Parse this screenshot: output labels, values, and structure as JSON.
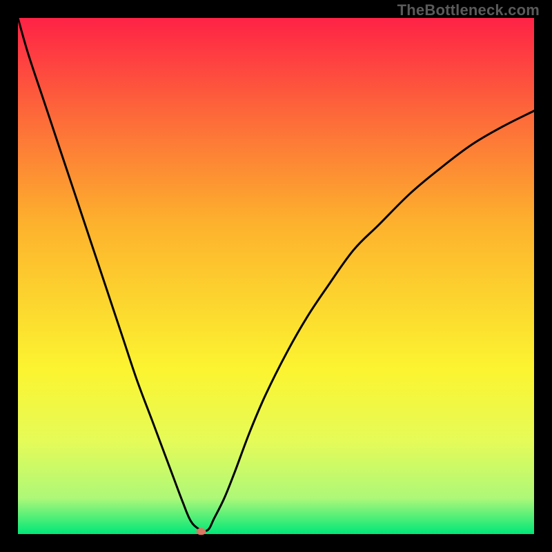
{
  "watermark": "TheBottleneck.com",
  "colors": {
    "gradient_top": "#fe2246",
    "gradient_mid1": "#fd663a",
    "gradient_mid2": "#fdb22d",
    "gradient_mid3": "#fcf430",
    "gradient_mid4": "#e5fb58",
    "gradient_mid5": "#aef878",
    "gradient_bottom": "#00e778",
    "curve": "#000000",
    "marker": "#d97863",
    "frame": "#000000"
  },
  "chart_data": {
    "type": "line",
    "title": "",
    "xlabel": "",
    "ylabel": "",
    "xlim": [
      0,
      100
    ],
    "ylim": [
      0,
      100
    ],
    "x": [
      0,
      2,
      5,
      8,
      11,
      14,
      17,
      20,
      23,
      26,
      29,
      32,
      33.5,
      35,
      36,
      37,
      38,
      40,
      42,
      45,
      48,
      52,
      56,
      60,
      65,
      70,
      76,
      82,
      88,
      94,
      100
    ],
    "values": [
      100,
      93,
      84,
      75,
      66,
      57,
      48,
      39,
      30,
      22,
      14,
      6,
      2.5,
      1,
      0.6,
      1,
      3,
      7,
      12,
      20,
      27,
      35,
      42,
      48,
      55,
      60,
      66,
      71,
      75.5,
      79,
      82
    ],
    "marker_point": {
      "x": 35.5,
      "y": 0.5
    },
    "notes": "V-shaped bottleneck curve; minimum near x≈35 where value≈0. Background is a vertical rainbow gradient from red (high) to green (low). No numeric axis ticks are shown in the image — x/y arrays are estimated from curve geometry."
  }
}
